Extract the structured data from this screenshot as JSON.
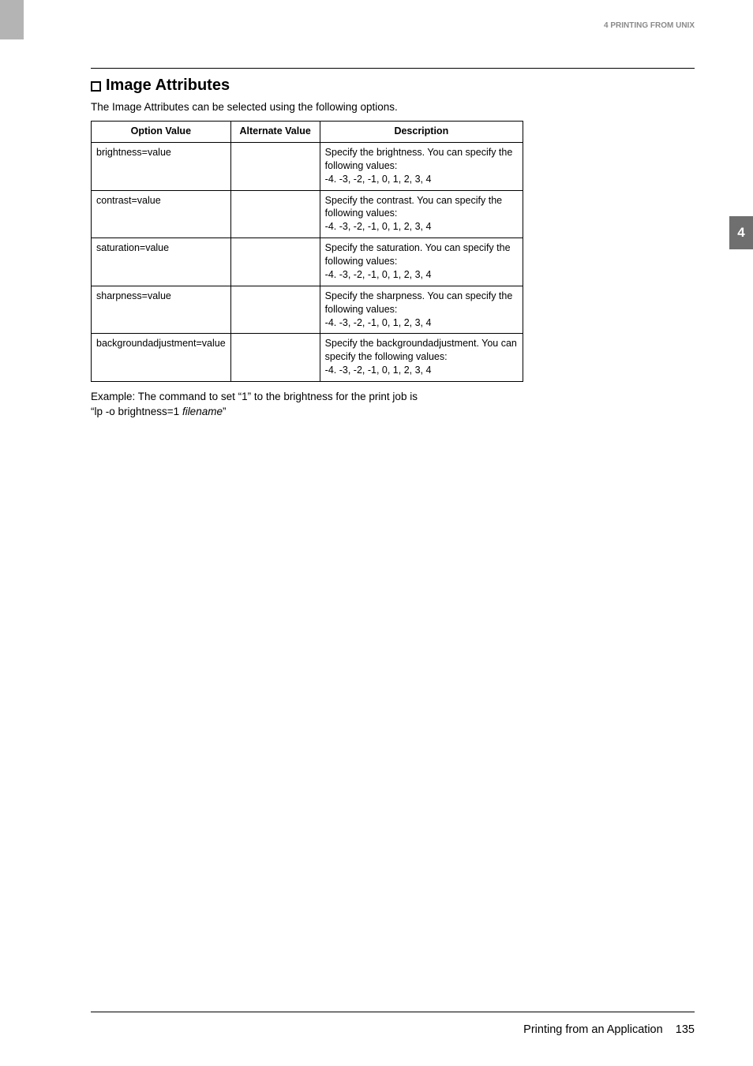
{
  "header": {
    "chapter_label": "4 PRINTING FROM UNIX"
  },
  "side_tab": {
    "number": "4"
  },
  "section": {
    "title": "Image Attributes",
    "intro": "The Image Attributes can be selected using the following options.",
    "table": {
      "headers": {
        "col1": "Option Value",
        "col2": "Alternate Value",
        "col3": "Description"
      },
      "rows": [
        {
          "option": "brightness=value",
          "alternate": "",
          "desc_line1": "Specify the brightness.  You can specify the following values:",
          "desc_line2": "-4. -3, -2, -1, 0, 1, 2, 3, 4"
        },
        {
          "option": "contrast=value",
          "alternate": "",
          "desc_line1": "Specify the contrast.  You can specify the following values:",
          "desc_line2": "-4. -3, -2, -1, 0, 1, 2, 3, 4"
        },
        {
          "option": "saturation=value",
          "alternate": "",
          "desc_line1": "Specify the saturation.  You can specify the following values:",
          "desc_line2": "-4. -3, -2, -1, 0, 1, 2, 3, 4"
        },
        {
          "option": "sharpness=value",
          "alternate": "",
          "desc_line1": "Specify the sharpness.  You can specify the following values:",
          "desc_line2": "-4. -3, -2, -1, 0, 1, 2, 3, 4"
        },
        {
          "option": "backgroundadjustment=value",
          "alternate": "",
          "desc_line1": "Specify the backgroundadjustment.  You can specify the following values:",
          "desc_line2": "-4. -3, -2, -1, 0, 1, 2, 3, 4"
        }
      ]
    },
    "example": {
      "line1": "Example: The command to set “1” to the brightness for the print job is",
      "line2_pre": "“lp -o brightness=1 ",
      "line2_italic": "filename",
      "line2_post": "”"
    }
  },
  "footer": {
    "label": "Printing from an Application",
    "page_no": "135"
  }
}
